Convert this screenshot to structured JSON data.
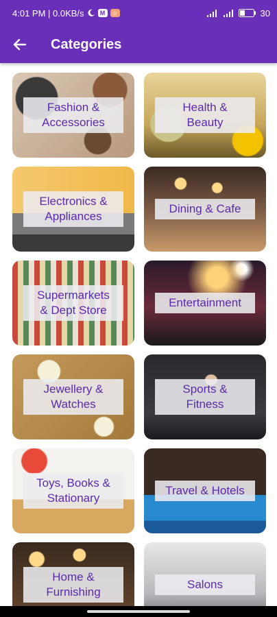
{
  "status_bar": {
    "time_speed": "4:01 PM | 0.0KB/s",
    "battery": "30",
    "icons": [
      "moon-icon",
      "gmail-icon",
      "app-notification-icon",
      "signal-icon",
      "4g-signal-icon",
      "battery-icon"
    ]
  },
  "app_bar": {
    "back_icon": "arrow-left-icon",
    "title": "Categories"
  },
  "colors": {
    "primary": "#6a2fb8",
    "label_text": "#5b2aa8",
    "label_bg": "#ececf0"
  },
  "categories": [
    {
      "label": "Fashion &\nAccessories"
    },
    {
      "label": "Health &\nBeauty"
    },
    {
      "label": "Electronics &\nAppliances"
    },
    {
      "label": "Dining & Cafe"
    },
    {
      "label": "Supermarkets\n& Dept Store"
    },
    {
      "label": "Entertainment"
    },
    {
      "label": "Jewellery &\nWatches"
    },
    {
      "label": "Sports &\nFitness"
    },
    {
      "label": "Toys, Books &\nStationary"
    },
    {
      "label": "Travel & Hotels"
    },
    {
      "label": "Home &\nFurnishing"
    },
    {
      "label": "Salons"
    }
  ]
}
